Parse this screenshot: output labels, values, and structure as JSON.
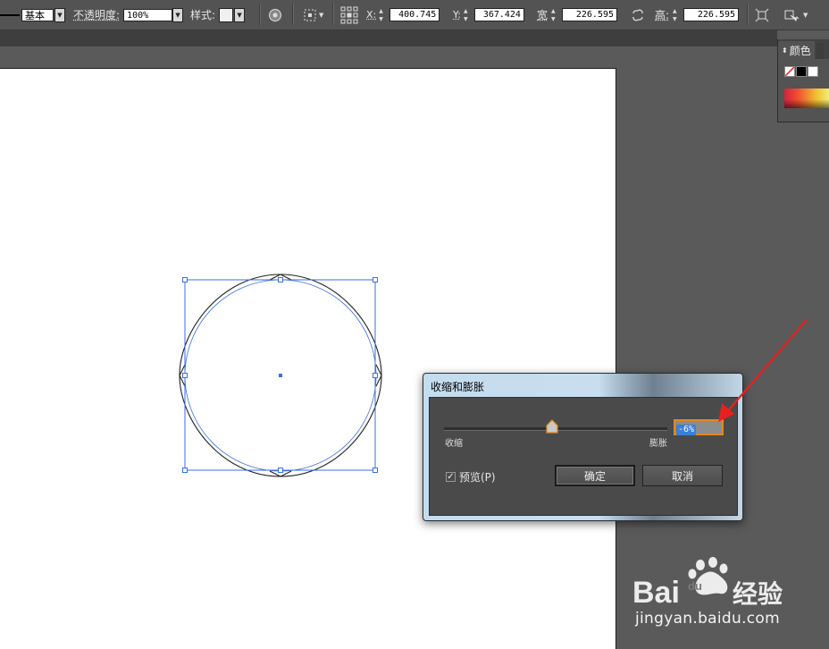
{
  "control_bar": {
    "stroke_profile": "基本",
    "opacity_label": "不透明度:",
    "opacity_value": "100%",
    "style_label": "样式:",
    "x_label": "X:",
    "x_value": "400.745",
    "y_label": "Y:",
    "y_value": "367.424",
    "width_label": "宽",
    "width_value": "226.595",
    "height_label": "高:",
    "height_value": "226.595"
  },
  "color_panel": {
    "tab_label": "颜色",
    "swatch_colors": [
      "#ffffff",
      "#000000",
      "#ffffff"
    ]
  },
  "dialog": {
    "title": "收缩和膨胀",
    "slider_value": -6,
    "value_text": "-6%",
    "shrink_label": "收缩",
    "grow_label": "膨胀",
    "preview_label": "预览(P)",
    "preview_checked": true,
    "ok_label": "确定",
    "cancel_label": "取消"
  },
  "watermark": {
    "site": "jingyan.baidu.com"
  },
  "colors": {
    "accent_orange": "#f0a030",
    "selection_blue": "#3a6fe0",
    "annotation_red": "#e82020"
  }
}
